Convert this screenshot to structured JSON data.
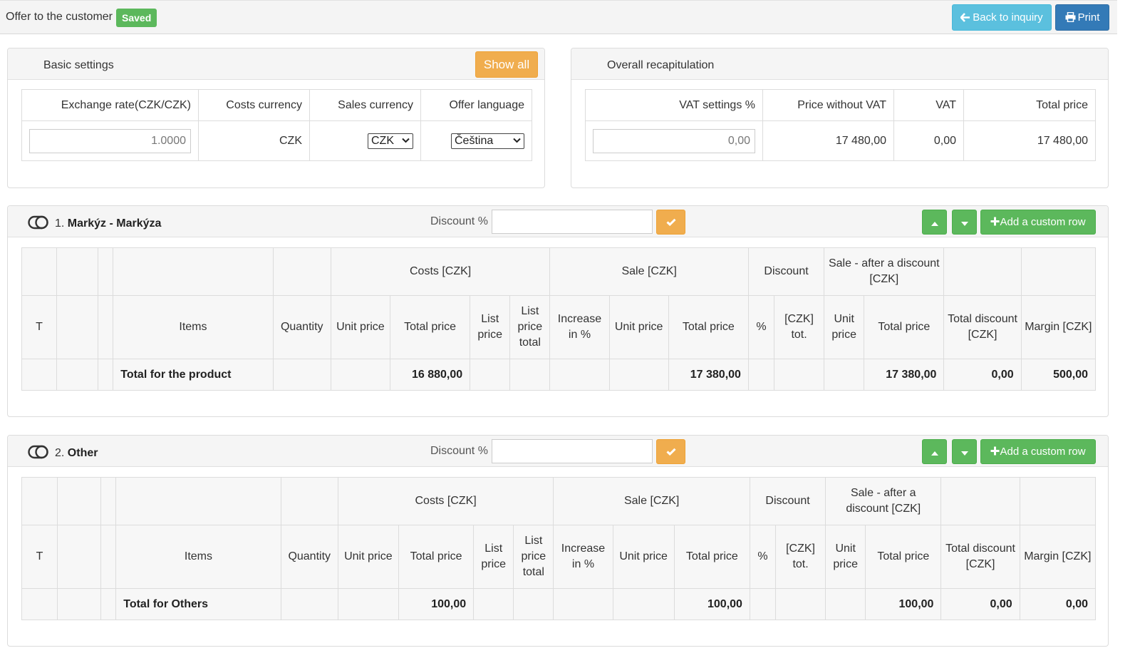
{
  "header": {
    "title": "Offer to the customer",
    "status_badge": "Saved",
    "back_label": "Back to inquiry",
    "print_label": "Print"
  },
  "basic_settings": {
    "title": "Basic settings",
    "show_all_label": "Show all",
    "columns": [
      "Exchange rate(CZK/CZK)",
      "Costs currency",
      "Sales currency",
      "Offer language"
    ],
    "exchange_rate_value": "1.0000",
    "costs_currency": "CZK",
    "sales_currency": "CZK",
    "offer_language": "Čeština"
  },
  "recapitulation": {
    "title": "Overall recapitulation",
    "columns": [
      "VAT settings %",
      "Price without VAT",
      "VAT",
      "Total price"
    ],
    "vat_settings_value": "0,00",
    "price_without_vat": "17 480,00",
    "vat": "0,00",
    "total_price": "17 480,00"
  },
  "table_headers": {
    "group": {
      "costs": "Costs [CZK]",
      "sale": "Sale [CZK]",
      "discount": "Discount",
      "sale_after": "Sale - after a discount [CZK]"
    },
    "cols": {
      "t": "T",
      "items": "Items",
      "quantity": "Quantity",
      "unit_price": "Unit price",
      "total_price": "Total price",
      "list_price": "List price",
      "list_price_total": "List price total",
      "increase": "Increase in %",
      "pct": "%",
      "czk_tot": "[CZK] tot.",
      "total_discount": "Total discount [CZK]",
      "margin": "Margin [CZK]"
    }
  },
  "sections": [
    {
      "number": "1.",
      "name": "Markýz - Markýza",
      "discount_label": "Discount %",
      "discount_value": "",
      "add_row_label": "Add a custom row",
      "total_label": "Total for the product",
      "costs_total": "16 880,00",
      "sale_total": "17 380,00",
      "sale_after_total": "17 380,00",
      "total_discount": "0,00",
      "margin": "500,00"
    },
    {
      "number": "2.",
      "name": "Other",
      "discount_label": "Discount %",
      "discount_value": "",
      "add_row_label": "Add a custom row",
      "total_label": "Total for Others",
      "costs_total": "100,00",
      "sale_total": "100,00",
      "sale_after_total": "100,00",
      "total_discount": "0,00",
      "margin": "0,00"
    }
  ],
  "colors": {
    "success": "#5cb85c",
    "info": "#5bc0de",
    "primary": "#337ab7",
    "warning": "#f0ad4e"
  }
}
